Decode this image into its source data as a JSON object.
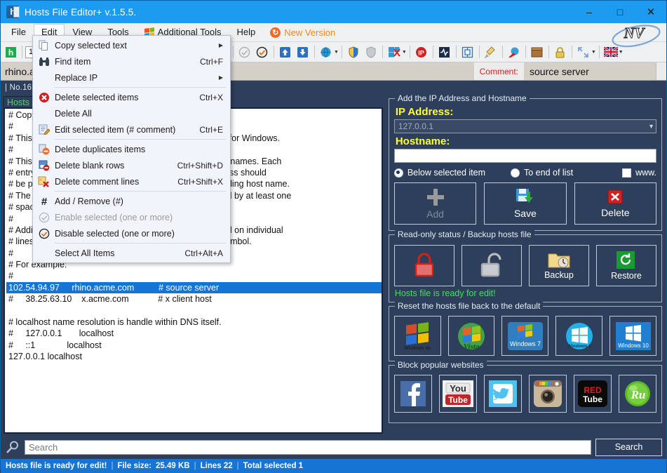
{
  "window": {
    "title": "Hosts File Editor+ v.1.5.5.",
    "app_icon": "hosts-file-icon",
    "minimize": "–",
    "maximize": "□",
    "close": "✕",
    "logo": "NV"
  },
  "menubar": {
    "items": [
      {
        "label": "File",
        "name": "menu-file",
        "open": false
      },
      {
        "label": "Edit",
        "name": "menu-edit",
        "open": true
      },
      {
        "label": "View",
        "name": "menu-view",
        "open": false
      },
      {
        "label": "Tools",
        "name": "menu-tools",
        "open": false
      },
      {
        "label": "Additional Tools",
        "name": "menu-additional-tools",
        "open": false,
        "icon": "windows-flag-icon"
      },
      {
        "label": "Help",
        "name": "menu-help",
        "open": false
      }
    ],
    "new_version": {
      "label": "New Version",
      "icon": "update-circle-icon",
      "color": "#f08a1c"
    }
  },
  "edit_menu": {
    "items": [
      {
        "label": "Copy selected text",
        "shortcut": "",
        "submenu": true,
        "icon": "copy-icon",
        "disabled": false
      },
      {
        "label": "Find item",
        "shortcut": "Ctrl+F",
        "submenu": false,
        "icon": "binoculars-icon",
        "disabled": false
      },
      {
        "label": "Replace IP",
        "shortcut": "",
        "submenu": true,
        "icon": "",
        "disabled": false
      },
      {
        "sep": true
      },
      {
        "label": "Delete selected items",
        "shortcut": "Ctrl+X",
        "submenu": false,
        "icon": "delete-red-x-icon",
        "disabled": false
      },
      {
        "label": "Delete All",
        "shortcut": "",
        "submenu": false,
        "icon": "",
        "disabled": false
      },
      {
        "label": "Edit selected item (# comment)",
        "shortcut": "Ctrl+E",
        "submenu": false,
        "icon": "edit-pencil-icon",
        "disabled": false
      },
      {
        "sep": true
      },
      {
        "label": "Delete duplicates items",
        "shortcut": "",
        "submenu": false,
        "icon": "delete-duplicates-icon",
        "disabled": false
      },
      {
        "label": "Delete blank rows",
        "shortcut": "Ctrl+Shift+D",
        "submenu": false,
        "icon": "delete-blank-rows-icon",
        "disabled": false
      },
      {
        "label": "Delete comment lines",
        "shortcut": "Ctrl+Shift+X",
        "submenu": false,
        "icon": "delete-comment-icon",
        "disabled": false
      },
      {
        "sep": true
      },
      {
        "label": "Add / Remove (#)",
        "shortcut": "",
        "submenu": false,
        "icon": "hash-icon",
        "disabled": false
      },
      {
        "label": "Enable selected (one or more)",
        "shortcut": "",
        "submenu": false,
        "icon": "check-circle-gray-icon",
        "disabled": true
      },
      {
        "label": "Disable selected (one or more)",
        "shortcut": "",
        "submenu": false,
        "icon": "check-circle-orange-icon",
        "disabled": false
      },
      {
        "sep": true
      },
      {
        "label": "Select All Items",
        "shortcut": "Ctrl+Alt+A",
        "submenu": false,
        "icon": "",
        "disabled": false
      }
    ]
  },
  "toolbar": {
    "font_size": "10",
    "icons": [
      "hosts-green-h-icon",
      "open-file-icon",
      "save-icon",
      "print-icon",
      "copy-icon",
      "find-icon",
      "delete-red-x-icon",
      "delete-comment-icon",
      "enable-check-gray-icon",
      "disable-check-orange-icon",
      "move-up-icon",
      "move-down-icon",
      "globe-icon",
      "shield-blue-icon",
      "shield-gray-icon",
      "block-site-icon",
      "ip-icon",
      "ping-icon",
      "flush-dns-icon",
      "clean-icon",
      "network-icon",
      "package-icon",
      "lock-icon",
      "resize-icon",
      "uk-flag-icon"
    ]
  },
  "selected_row": {
    "text": "rhino.acme.com",
    "comment_label": "Comment:",
    "comment_value": "source server"
  },
  "file_info": {
    "number": "| No.16 |",
    "file_size_label": "File size:",
    "file_size": "25.49 KB"
  },
  "editor": {
    "tab_label": "Hosts",
    "lines": [
      {
        "text": "# Copyright (c) 1993-2009 Microsoft Corp.",
        "selected": false
      },
      {
        "text": "#",
        "selected": false
      },
      {
        "text": "# This is a sample HOSTS file used by Microsoft TCP/IP for Windows.",
        "selected": false
      },
      {
        "text": "#",
        "selected": false
      },
      {
        "text": "# This file contains the mappings of IP addresses to host names. Each",
        "selected": false
      },
      {
        "text": "# entry should be kept on an individual line. The IP address should",
        "selected": false
      },
      {
        "text": "# be placed in the first column followed by the corresponding host name.",
        "selected": false
      },
      {
        "text": "# The IP address and the host name should be separated by at least one",
        "selected": false
      },
      {
        "text": "# space.",
        "selected": false
      },
      {
        "text": "#",
        "selected": false
      },
      {
        "text": "# Additionally, comments (such as these) may be inserted on individual",
        "selected": false
      },
      {
        "text": "# lines or following the machine name denoted by a '#' symbol.",
        "selected": false
      },
      {
        "text": "#",
        "selected": false
      },
      {
        "text": "# For example:",
        "selected": false
      },
      {
        "text": "#",
        "selected": false
      },
      {
        "text": "102.54.94.97     rhino.acme.com          # source server",
        "selected": true
      },
      {
        "text": "#     38.25.63.10    x.acme.com            # x client host",
        "selected": false
      },
      {
        "text": "",
        "selected": false
      },
      {
        "text": "# localhost name resolution is handle within DNS itself.",
        "selected": false
      },
      {
        "text": "#     127.0.0.1       localhost",
        "selected": false
      },
      {
        "text": "#     ::1             localhost",
        "selected": false
      },
      {
        "text": "127.0.0.1 localhost",
        "selected": false
      }
    ]
  },
  "add_panel": {
    "legend": "Add the IP Address  and Hostname",
    "ip_label": "IP Address:",
    "ip_value": "127.0.0.1",
    "hostname_label": "Hostname:",
    "hostname_value": "",
    "radio_below": "Below selected item",
    "radio_end": "To end of list",
    "checkbox_www": "www.",
    "buttons": [
      {
        "label": "Add",
        "icon": "plus-gray-icon",
        "disabled": true,
        "name": "add-button"
      },
      {
        "label": "Save",
        "icon": "save-floppy-icon",
        "disabled": false,
        "name": "save-button"
      },
      {
        "label": "Delete",
        "icon": "delete-red-x-icon",
        "disabled": false,
        "name": "delete-button"
      }
    ]
  },
  "readonly_panel": {
    "legend": "Read-only status / Backup hosts file",
    "buttons": [
      {
        "label": "",
        "icon": "lock-closed-red-icon",
        "name": "set-readonly-button"
      },
      {
        "label": "",
        "icon": "lock-open-gray-icon",
        "name": "unset-readonly-button"
      },
      {
        "label": "Backup",
        "icon": "backup-folder-icon",
        "name": "backup-button"
      },
      {
        "label": "Restore",
        "icon": "restore-clock-icon",
        "name": "restore-button"
      }
    ],
    "status": "Hosts file is ready for edit!"
  },
  "reset_panel": {
    "legend": "Reset the hosts file back to the default",
    "buttons": [
      {
        "label": "Windows XP",
        "icon": "windows-xp-icon",
        "name": "reset-winxp-button"
      },
      {
        "label": "Vista",
        "icon": "windows-vista-icon",
        "name": "reset-vista-button"
      },
      {
        "label": "Windows 7",
        "icon": "windows-7-icon",
        "name": "reset-win7-button"
      },
      {
        "label": "Windows 8",
        "icon": "windows-8-icon",
        "name": "reset-win8-button"
      },
      {
        "label": "Windows 10",
        "icon": "windows-10-icon",
        "name": "reset-win10-button"
      }
    ]
  },
  "block_panel": {
    "legend": "Block popular websites",
    "buttons": [
      {
        "label": "f",
        "icon": "facebook-icon",
        "name": "block-facebook-button"
      },
      {
        "label": "You Tube",
        "icon": "youtube-icon",
        "name": "block-youtube-button"
      },
      {
        "label": "t",
        "icon": "twitter-icon",
        "name": "block-twitter-button"
      },
      {
        "label": "",
        "icon": "instagram-icon",
        "name": "block-instagram-button"
      },
      {
        "label": "RED Tube",
        "icon": "redtube-icon",
        "name": "block-redtube-button"
      },
      {
        "label": "Ru",
        "icon": "rutube-icon",
        "name": "block-ru-button"
      }
    ]
  },
  "search": {
    "placeholder": "Search",
    "value": "",
    "button_label": "Search",
    "icon": "magnifier-icon"
  },
  "statusbar": {
    "status": "Hosts file is ready for edit!",
    "file_size_label": "File size:",
    "file_size": "25.49 KB",
    "lines": "Lines 22",
    "selected": "Total selected 1",
    "sep": "|"
  }
}
